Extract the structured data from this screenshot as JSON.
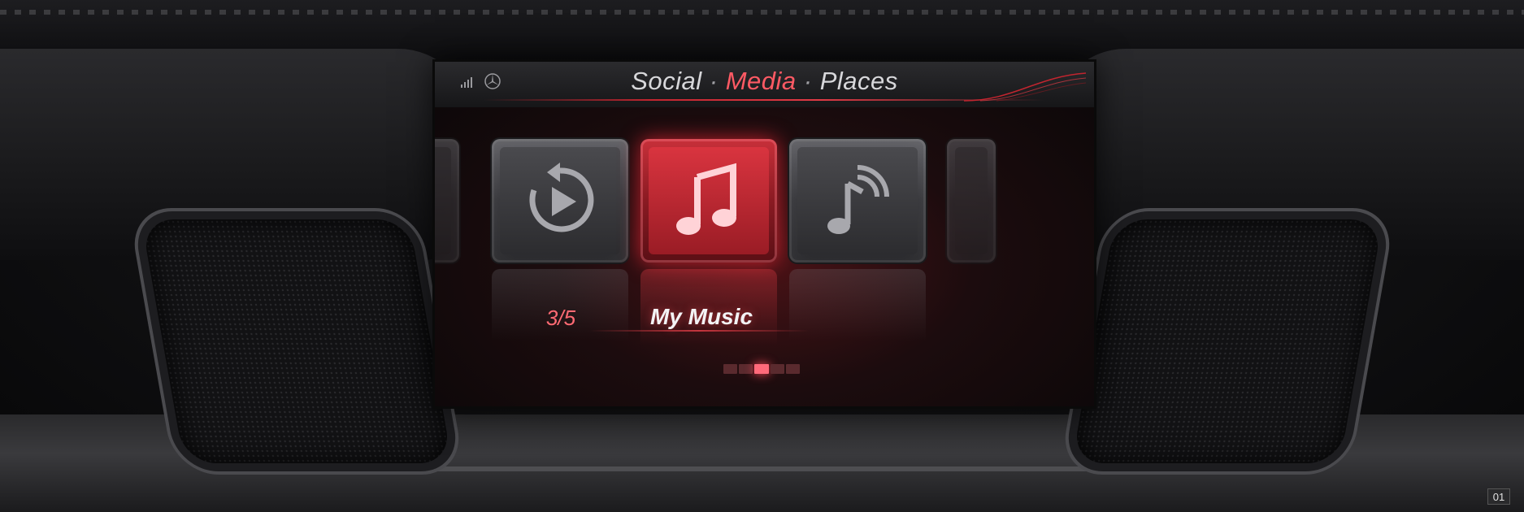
{
  "screen": {
    "status_icons": [
      "signal-icon",
      "mercedes-star-icon"
    ],
    "title": {
      "items": [
        "Social",
        "Media",
        "Places"
      ],
      "separator": "·",
      "active_index": 1
    },
    "carousel": {
      "tiles": [
        {
          "name": "partial-tile-left",
          "icon": "none"
        },
        {
          "name": "replay-tile",
          "icon": "replay-icon"
        },
        {
          "name": "my-music-tile",
          "icon": "music-note-icon",
          "active": true
        },
        {
          "name": "online-music-tile",
          "icon": "streaming-music-icon"
        },
        {
          "name": "partial-tile-right",
          "icon": "none"
        }
      ],
      "counter": "3/5",
      "active_label": "My Music",
      "pager_total": 5,
      "pager_active": 3
    },
    "colors": {
      "accent": "#ff5a64",
      "active_tile": "#c8303a"
    }
  },
  "page_number": "01"
}
